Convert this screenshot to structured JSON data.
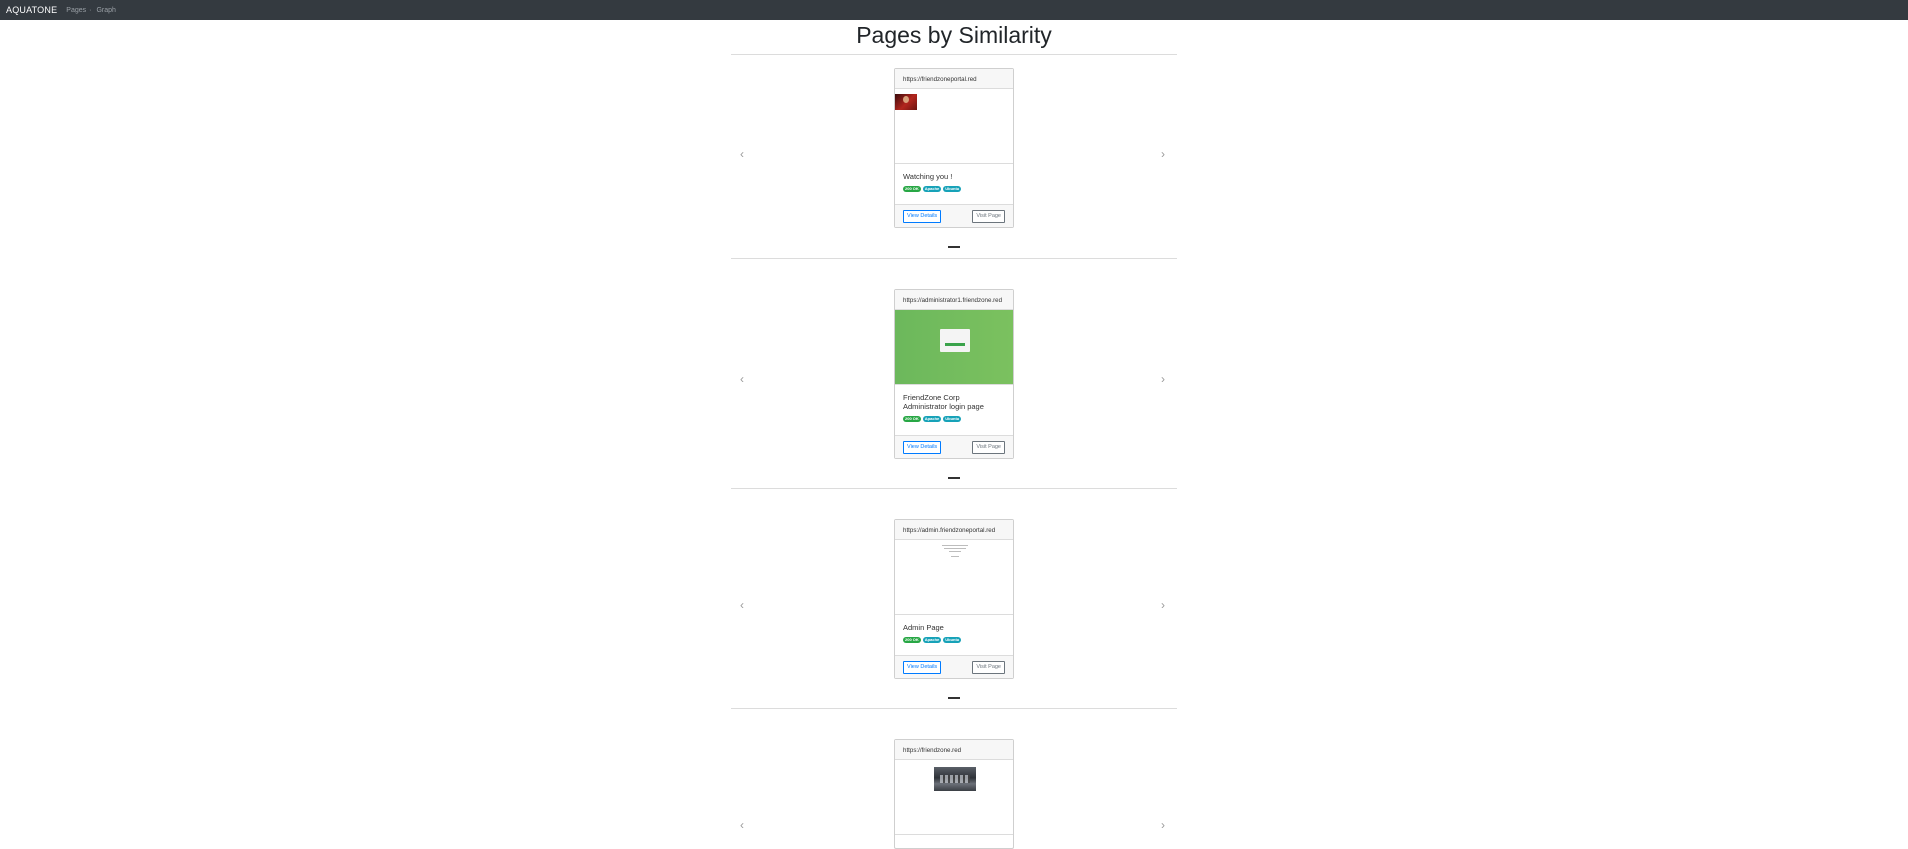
{
  "navbar": {
    "brand": "AQUATONE",
    "links": [
      {
        "label": "Pages"
      },
      {
        "label": "Graph"
      }
    ],
    "separator": "·"
  },
  "heading": "Pages by Similarity",
  "carousel": {
    "prev_icon": "chevron-left-icon",
    "next_icon": "chevron-right-icon"
  },
  "cards": [
    {
      "url": "https://friendzoneportal.red",
      "title": "Watching you !",
      "tags": [
        "200 OK",
        "Apache",
        "Ubuntu"
      ],
      "view_label": "View Details",
      "visit_label": "Visit Page"
    },
    {
      "url": "https://administrator1.friendzone.red",
      "title": "FriendZone Corp Administrator login page",
      "tags": [
        "200 OK",
        "Apache",
        "Ubuntu"
      ],
      "view_label": "View Details",
      "visit_label": "Visit Page"
    },
    {
      "url": "https://admin.friendzoneportal.red",
      "title": "Admin Page",
      "tags": [
        "200 OK",
        "Apache",
        "Ubuntu"
      ],
      "view_label": "View Details",
      "visit_label": "Visit Page"
    },
    {
      "url": "https://friendzone.red"
    }
  ],
  "colors": {
    "navbar": "#343a40",
    "status_ok": "#28a745",
    "tag_info": "#17a2b8",
    "primary": "#007bff"
  }
}
